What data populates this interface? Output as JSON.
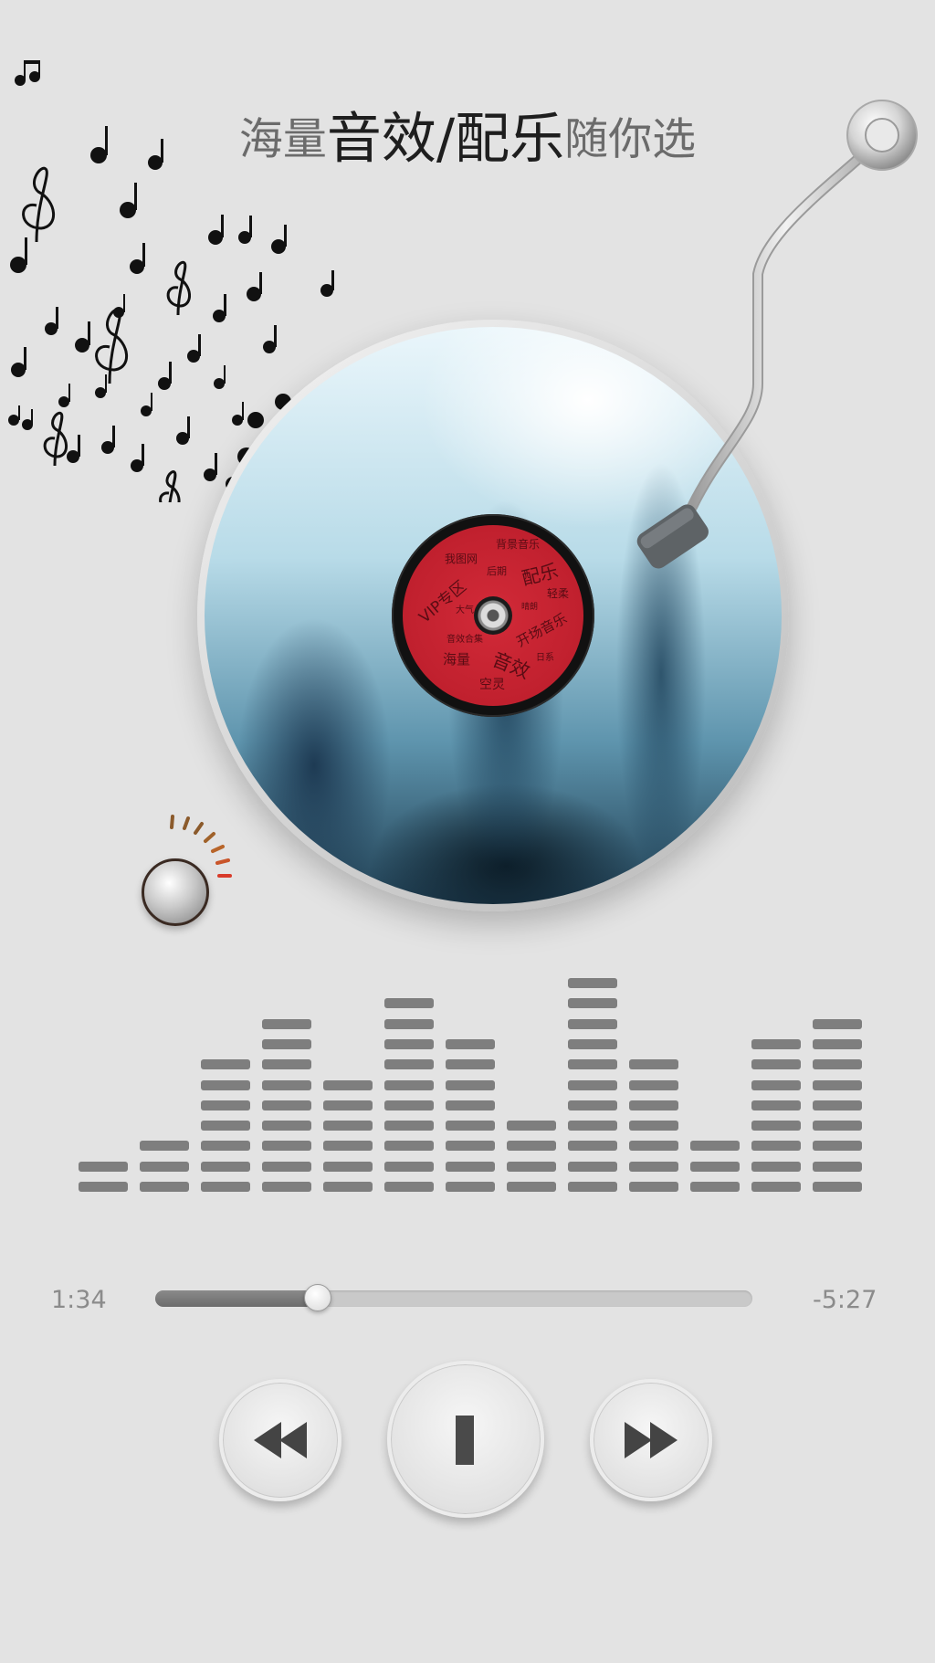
{
  "headline": {
    "prefix": "海量",
    "emphasis": "音效/配乐",
    "suffix": "随你选"
  },
  "record": {
    "label_words": [
      "背景音乐",
      "我图网",
      "配乐",
      "后期",
      "轻柔",
      "VIP专区",
      "大气",
      "晴朗",
      "开场音乐",
      "音效合集",
      "日系",
      "海量",
      "音效",
      "空灵"
    ],
    "label_color": "#c0202e"
  },
  "player": {
    "elapsed": "1:34",
    "remaining": "-5:27",
    "progress_fraction": 0.27
  },
  "equalizer": {
    "levels": [
      2,
      3,
      7,
      9,
      6,
      10,
      8,
      4,
      11,
      7,
      3,
      8,
      9
    ]
  },
  "controls": {
    "rewind_icon": "rewind-icon",
    "pause_icon": "pause-icon",
    "fast_forward_icon": "fast-forward-icon"
  },
  "colors": {
    "background": "#e3e3e3",
    "label_red": "#c0202e",
    "eq_bar": "#7e7e7e"
  }
}
